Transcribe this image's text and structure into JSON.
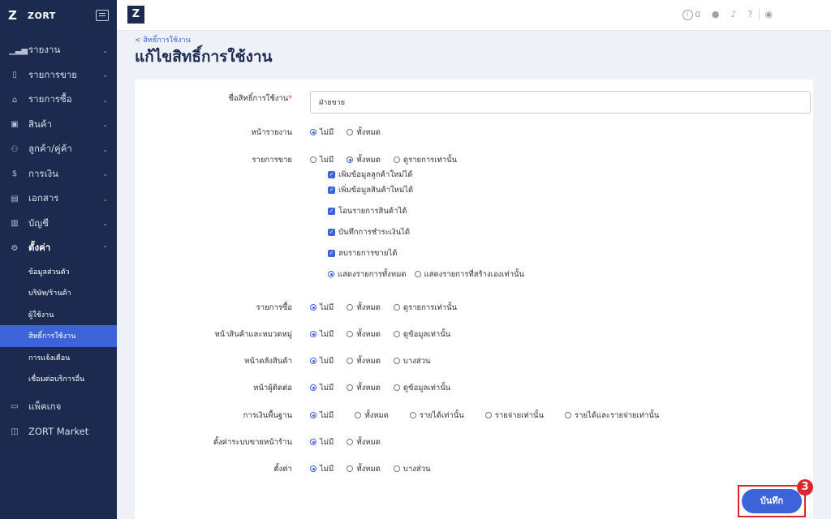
{
  "brand": {
    "name": "ZORT",
    "logo": "Z"
  },
  "sidebar": {
    "items": [
      {
        "label": "รายงาน",
        "icon": "chart-icon",
        "glyph": "📊"
      },
      {
        "label": "รายการขาย",
        "icon": "clipboard-icon",
        "glyph": "📋"
      },
      {
        "label": "รายการซื้อ",
        "icon": "basket-icon",
        "glyph": "🛒"
      },
      {
        "label": "สินค้า",
        "icon": "box-icon",
        "glyph": "▣"
      },
      {
        "label": "ลูกค้า/คู่ค้า",
        "icon": "users-icon",
        "glyph": "👥"
      },
      {
        "label": "การเงิน",
        "icon": "dollar-icon",
        "glyph": "$"
      },
      {
        "label": "เอกสาร",
        "icon": "document-icon",
        "glyph": "▤"
      },
      {
        "label": "บัญชี",
        "icon": "ledger-icon",
        "glyph": "▥"
      },
      {
        "label": "ตั้งค่า",
        "icon": "gear-icon",
        "glyph": "⚙"
      }
    ],
    "sub_items": [
      "ข้อมูลส่วนตัว",
      "บริษัท/ร้านค้า",
      "ผู้ใช้งาน",
      "สิทธิ์การใช้งาน",
      "การแจ้งเตือน",
      "เชื่อมต่อบริการอื่น"
    ],
    "bottom_items": [
      {
        "label": "แพ็คเกจ",
        "icon": "package-icon",
        "glyph": "▭"
      },
      {
        "label": "ZORT Market",
        "icon": "bag-icon",
        "glyph": "◫"
      }
    ]
  },
  "topbar": {
    "notification_count": "0"
  },
  "breadcrumb": "< สิทธิ์การใช้งาน",
  "page_title": "แก้ไขสิทธิ์การใช้งาน",
  "form": {
    "name_label": "ชื่อสิทธิ์การใช้งาน",
    "required_mark": "*",
    "name_value": "ฝ่ายขาย",
    "report": {
      "label": "หน้ารายงาน",
      "opt1": "ไม่มี",
      "opt2": "ทั้งหมด"
    },
    "sales": {
      "label": "รายการขาย",
      "opt1": "ไม่มี",
      "opt2": "ทั้งหมด",
      "opt3": "ดูรายการเท่านั้น",
      "chk1": "เพิ่มข้อมูลลูกค้าใหม่ได้",
      "chk2": "เพิ่มข้อมูลสินค้าใหม่ได้",
      "chk3": "โอนรายการสินค้าได้",
      "chk4": "บันทึกการชำระเงินได้",
      "chk5": "ลบรายการขายได้",
      "scope1": "แสดงรายการทั้งหมด",
      "scope2": "แสดงรายการที่สร้างเองเท่านั้น"
    },
    "purchase": {
      "label": "รายการซื้อ",
      "opt1": "ไม่มี",
      "opt2": "ทั้งหมด",
      "opt3": "ดูรายการเท่านั้น"
    },
    "products": {
      "label": "หน้าสินค้าและหมวดหมู่",
      "opt1": "ไม่มี",
      "opt2": "ทั้งหมด",
      "opt3": "ดูข้อมูลเท่านั้น"
    },
    "warehouse": {
      "label": "หน้าคลังสินค้า",
      "opt1": "ไม่มี",
      "opt2": "ทั้งหมด",
      "opt3": "บางส่วน"
    },
    "contacts": {
      "label": "หน้าผู้ติดต่อ",
      "opt1": "ไม่มี",
      "opt2": "ทั้งหมด",
      "opt3": "ดูข้อมูลเท่านั้น"
    },
    "finance": {
      "label": "การเงินพื้นฐาน",
      "opt1": "ไม่มี",
      "opt2": "ทั้งหมด",
      "opt3": "รายได้เท่านั้น",
      "opt4": "รายจ่ายเท่านั้น",
      "opt5": "รายได้และรายจ่ายเท่านั้น"
    },
    "pos": {
      "label": "ตั้งค่าระบบขายหน้าร้าน",
      "opt1": "ไม่มี",
      "opt2": "ทั้งหมด"
    },
    "settings": {
      "label": "ตั้งค่า",
      "opt1": "ไม่มี",
      "opt2": "ทั้งหมด",
      "opt3": "บางส่วน"
    }
  },
  "save_button": "บันทึก",
  "step_badge": "3"
}
